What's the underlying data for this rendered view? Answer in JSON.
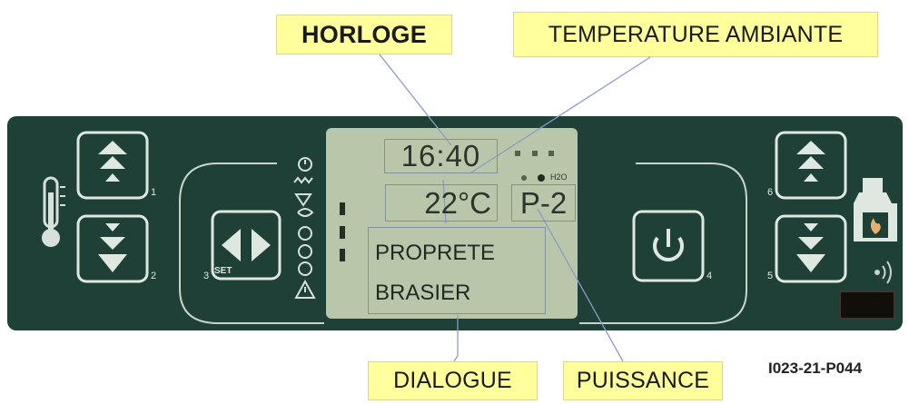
{
  "callouts": {
    "horloge": "HORLOGE",
    "temperature_ambiante": "TEMPERATURE AMBIANTE",
    "dialogue": "DIALOGUE",
    "puissance": "PUISSANCE"
  },
  "reference_code": "I023-21-P044",
  "display": {
    "clock": "16:40",
    "temperature": "22°C",
    "power": "P-2",
    "dialog_line_1": "PROPRETE",
    "dialog_line_2": "BRASIER",
    "h2o_label": "H2O"
  },
  "buttons": {
    "b1_number": "1",
    "b2_number": "2",
    "b3_number": "3",
    "b3_set_label": "SET",
    "b4_number": "4",
    "b5_number": "5",
    "b6_number": "6"
  },
  "icons": {
    "left_side": "thermometer-icon",
    "right_side": "fireplace-icon",
    "status_column": [
      "clock-icon",
      "resistance-icon",
      "pellet-icon",
      "fan-icon",
      "flame-icon",
      "pump-icon",
      "alarm-icon"
    ],
    "buttons": [
      "triple-up-arrow-icon",
      "triple-down-arrow-icon",
      "left-right-arrows-icon",
      "power-icon"
    ]
  },
  "colors": {
    "panel": "#1e4037",
    "lcd": "#b9c6a9",
    "callout": "#ffff9c",
    "callout_line": "#8a9cc4"
  }
}
